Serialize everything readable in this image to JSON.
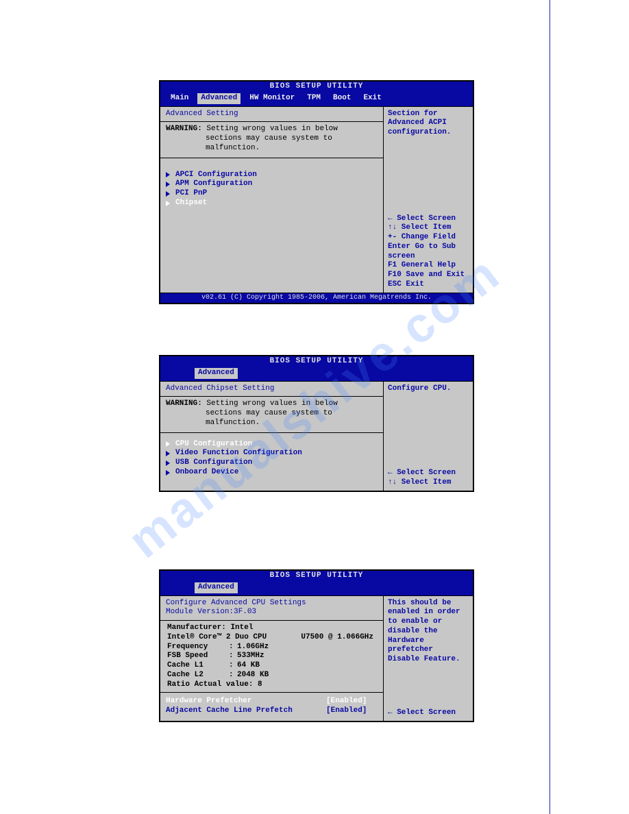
{
  "watermark": "manualshive.com",
  "bios1": {
    "title": "BIOS SETUP UTILITY",
    "tabs": [
      "Main",
      "Advanced",
      "HW Monitor",
      "TPM",
      "Boot",
      "Exit"
    ],
    "active_tab": "Advanced",
    "section_header": "Advanced Setting",
    "warning_label": "WARNING:",
    "warning_l1": "Setting wrong values in below",
    "warning_l2": "sections may cause system to",
    "warning_l3": "malfunction.",
    "items": [
      {
        "label": "APCI Configuration",
        "selected": false
      },
      {
        "label": "APM Configuration",
        "selected": false
      },
      {
        "label": "PCI PnP",
        "selected": false
      },
      {
        "label": "Chipset",
        "selected": true
      }
    ],
    "help_text": "Section for Advanced ACPI configuration.",
    "keys": [
      "← Select Screen",
      "↑↓ Select Item",
      "+- Change Field",
      "Enter Go to Sub",
      "screen",
      "F1  General Help",
      "F10 Save and Exit",
      "ESC Exit"
    ],
    "footer": "v02.61 (C) Copyright 1985-2006, American Megatrends Inc."
  },
  "bios2": {
    "title": "BIOS SETUP UTILITY",
    "active_tab": "Advanced",
    "section_header": "Advanced Chipset Setting",
    "warning_label": "WARNING:",
    "warning_l1": "Setting wrong values in below",
    "warning_l2": "sections may cause system to",
    "warning_l3": "malfunction.",
    "items": [
      {
        "label": "CPU Configuration",
        "selected": true
      },
      {
        "label": "Video Function Configuration",
        "selected": false
      },
      {
        "label": "USB Configuration",
        "selected": false
      },
      {
        "label": "Onboard Device",
        "selected": false
      }
    ],
    "help_text": "Configure CPU.",
    "keys": [
      "← Select Screen",
      "↑↓ Select Item"
    ]
  },
  "bios3": {
    "title": "BIOS SETUP UTILITY",
    "active_tab": "Advanced",
    "header_l1": "Configure Advanced CPU Settings",
    "header_l2": "Module Version:3F.03",
    "manufacturer_label": "Manufacturer:",
    "manufacturer_value": "Intel",
    "cpu_line": "Intel® Core™ 2 Duo CPU",
    "cpu_model": "U7500 @ 1.066GHz",
    "rows": [
      {
        "k": "Frequency",
        "v": "1.06GHz"
      },
      {
        "k": "FSB Speed",
        "v": "533MHz"
      },
      {
        "k": "Cache L1",
        "v": "64 KB"
      },
      {
        "k": "Cache L2",
        "v": "2048 KB"
      }
    ],
    "ratio_line": "Ratio Actual value: 8",
    "options": [
      {
        "label": "Hardware Prefetcher",
        "value": "[Enabled]",
        "selected": true
      },
      {
        "label": "Adjacent Cache Line Prefetch",
        "value": "[Enabled]",
        "selected": false
      }
    ],
    "help_text": "This should be enabled in order to enable or disable the Hardware prefetcher Disable Feature.",
    "keys": [
      "← Select Screen"
    ]
  }
}
